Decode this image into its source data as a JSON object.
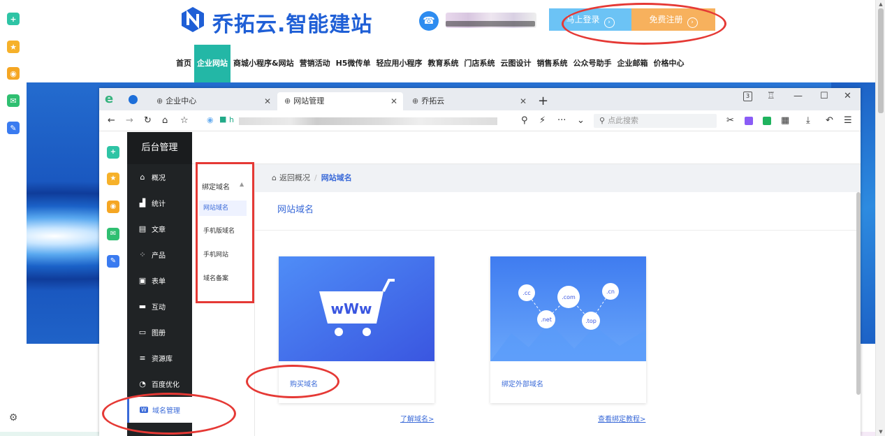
{
  "header": {
    "logo_text": "乔拓云.智能建站",
    "login_button": "马上登录",
    "register_button": "免费注册",
    "nav": [
      "首页",
      "企业网站",
      "商城小程序&网站",
      "营销活动",
      "H5微传单",
      "轻应用小程序",
      "教育系统",
      "门店系统",
      "云图设计",
      "销售系统",
      "公众号助手",
      "企业邮箱",
      "价格中心"
    ],
    "nav_active_index": 1
  },
  "browser": {
    "tabs": [
      {
        "label": "企业中心",
        "active": false
      },
      {
        "label": "网站管理",
        "active": true
      },
      {
        "label": "乔拓云",
        "active": false
      }
    ],
    "url_prefix": "h",
    "search_placeholder": "点此搜索",
    "tab_count_badge": "3"
  },
  "admin": {
    "title": "后台管理",
    "menu": [
      {
        "label": "概况",
        "icon": "home-icon"
      },
      {
        "label": "统计",
        "icon": "stats-icon"
      },
      {
        "label": "文章",
        "icon": "article-icon"
      },
      {
        "label": "产品",
        "icon": "product-icon"
      },
      {
        "label": "表单",
        "icon": "form-icon"
      },
      {
        "label": "互动",
        "icon": "chat-icon"
      },
      {
        "label": "图册",
        "icon": "album-icon"
      },
      {
        "label": "资源库",
        "icon": "database-icon"
      },
      {
        "label": "百度优化",
        "icon": "seo-icon"
      }
    ],
    "active_item": "域名管理"
  },
  "sub_menu": {
    "group": "绑定域名",
    "items": [
      "网站域名",
      "手机版域名",
      "手机网站",
      "域名备案"
    ],
    "active_index": 0
  },
  "main": {
    "breadcrumb_home": "返回概况",
    "breadcrumb_current": "网站域名",
    "title": "网站域名",
    "cards": [
      {
        "label": "购买域名",
        "link": "了解域名>",
        "art_text": "wWw"
      },
      {
        "label": "绑定外部域名",
        "link": "查看绑定教程>",
        "tags": [
          ".cc",
          ".com",
          ".cn",
          ".net",
          ".top"
        ]
      }
    ]
  },
  "colors": {
    "accent": "#3a6ad8",
    "nav_active": "#23b7a6",
    "login_btn": "#6cc3f5",
    "register_btn": "#f7b15d",
    "annotation": "#e53935"
  }
}
